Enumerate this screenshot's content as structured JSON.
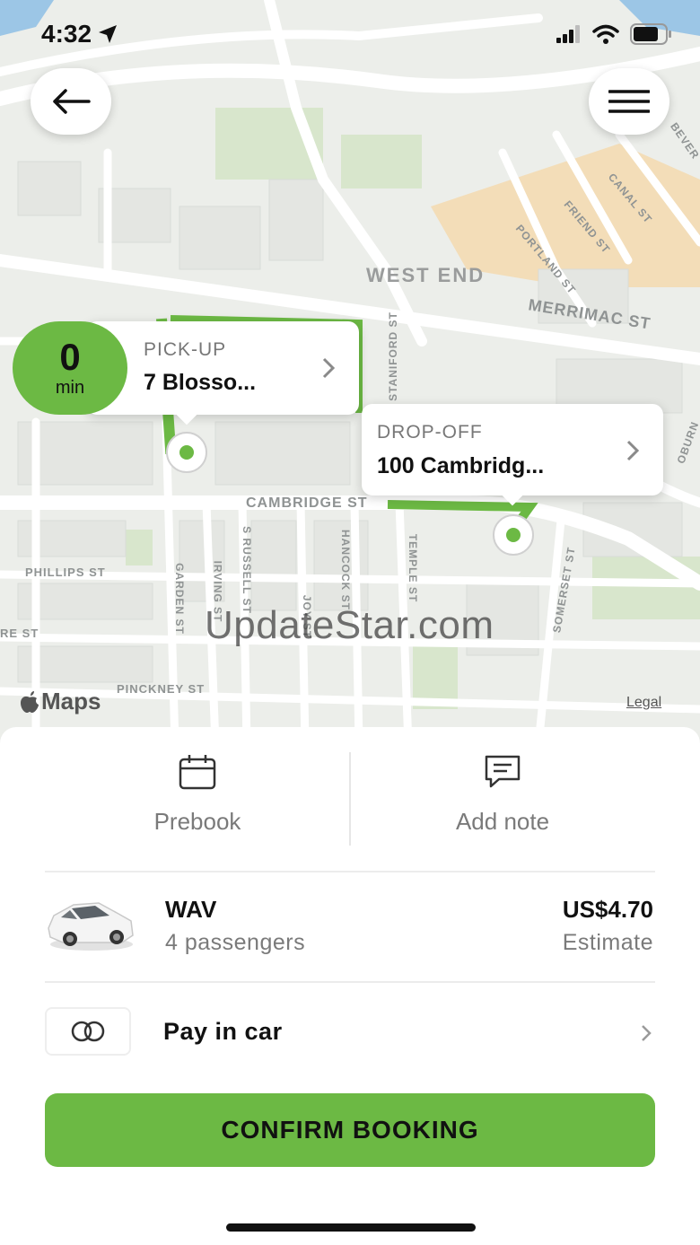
{
  "status_bar": {
    "time": "4:32"
  },
  "map": {
    "district": "WEST END",
    "streets": {
      "merrimac": "MERRIMAC ST",
      "cambridge": "CAMBRIDGE ST",
      "phillips": "PHILLIPS ST",
      "pinckney": "PINCKNEY ST",
      "staniford": "STANIFORD ST",
      "s_russell": "S RUSSELL ST",
      "hancock": "HANCOCK ST",
      "temple": "TEMPLE ST",
      "somerset": "SOMERSET ST",
      "garden": "GARDEN ST",
      "irving": "IRVING ST",
      "joy": "JOY ST",
      "friend": "FRIEND ST",
      "canal": "CANAL ST",
      "portland": "PORTLAND ST",
      "beverly": "BEVER",
      "re_st": "RE ST",
      "oburn": "OBURN"
    },
    "attribution": "Maps",
    "legal": "Legal",
    "watermark": "UpdateStar.com"
  },
  "eta": {
    "value": "0",
    "unit": "min"
  },
  "pickup": {
    "label": "PICK-UP",
    "address": "7 Blosso..."
  },
  "dropoff": {
    "label": "DROP-OFF",
    "address": "100 Cambridg..."
  },
  "options": {
    "prebook": "Prebook",
    "add_note": "Add note"
  },
  "vehicle": {
    "name": "WAV",
    "capacity": "4 passengers",
    "price": "US$4.70",
    "price_note": "Estimate"
  },
  "payment": {
    "label": "Pay in car"
  },
  "confirm_label": "CONFIRM BOOKING",
  "colors": {
    "accent": "#6cb944",
    "map_bg": "#eceeea",
    "road": "#ffffff",
    "district_fill": "#f3ddb8"
  }
}
